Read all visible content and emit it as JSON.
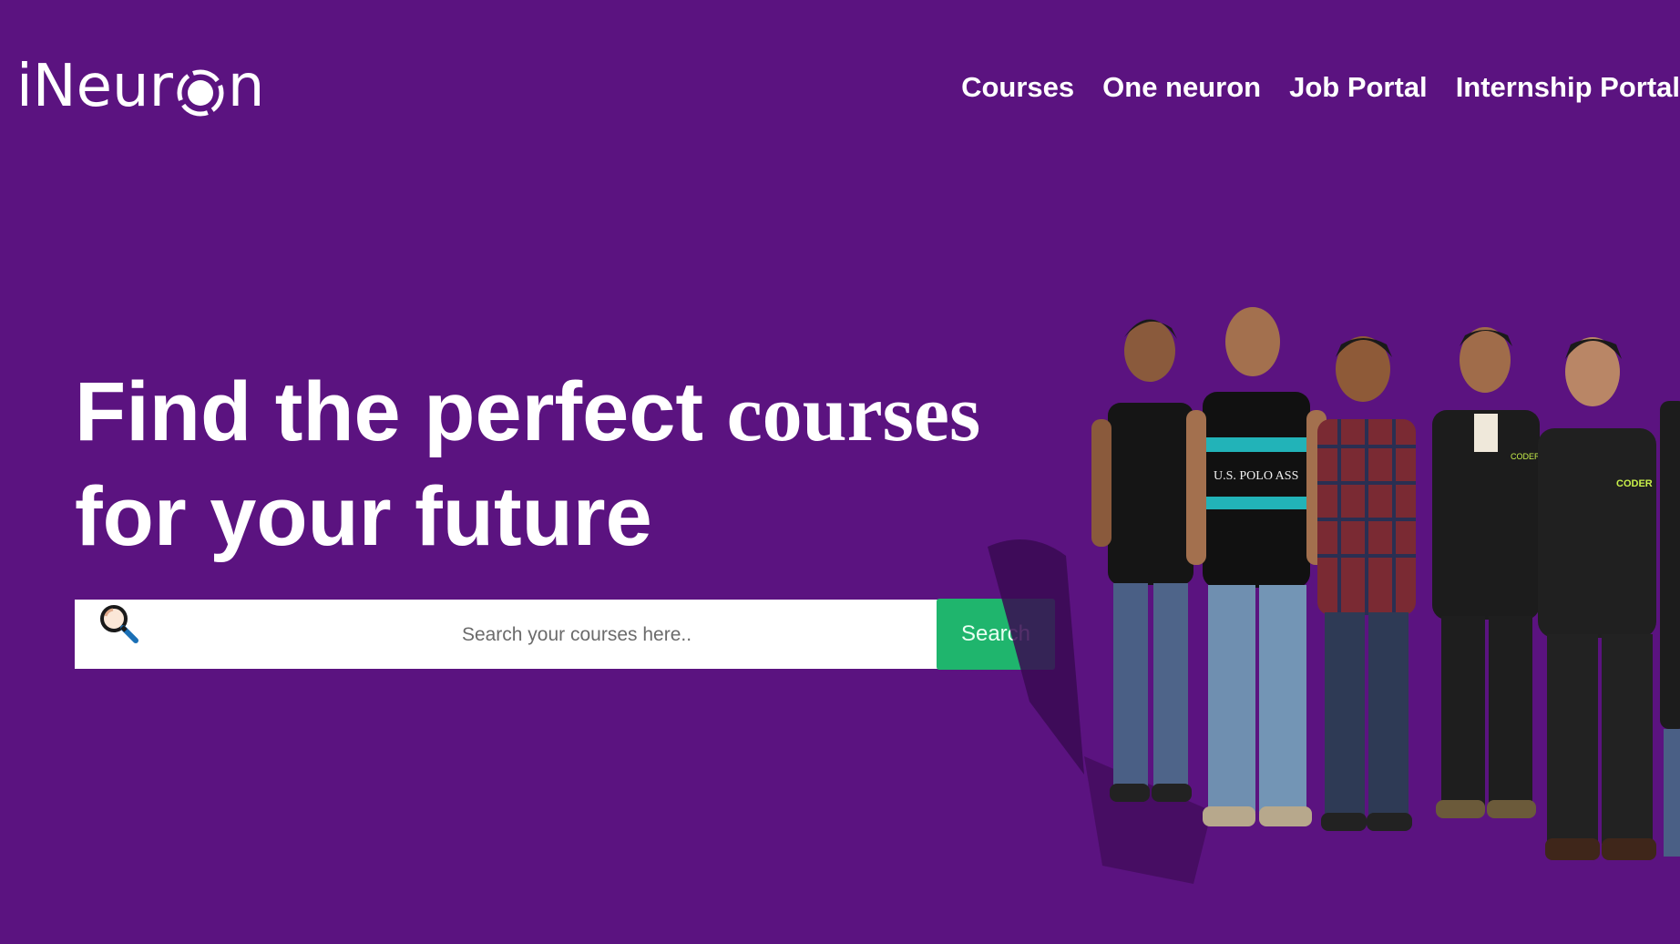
{
  "brand": {
    "logo_text_before": "iNeur",
    "logo_text_after": "n"
  },
  "nav": {
    "items": [
      {
        "label": "Courses"
      },
      {
        "label": "One neuron"
      },
      {
        "label": "Job Portal"
      },
      {
        "label": "Internship Portal"
      }
    ]
  },
  "hero": {
    "title_part1": "Find the perfect ",
    "title_serif": "courses",
    "title_line2": "for your future"
  },
  "search": {
    "placeholder": "Search your courses here..",
    "button_label": "Search"
  },
  "team_image": {
    "shirt_text_1": "U.S. POLO ASS",
    "shirt_text_2": "CODER",
    "shirt_text_3": "CODER"
  },
  "colors": {
    "background": "#5b1380",
    "search_button": "#1fb56d",
    "text": "#ffffff"
  },
  "icons": [
    "logo-ring-icon",
    "search-icon"
  ]
}
